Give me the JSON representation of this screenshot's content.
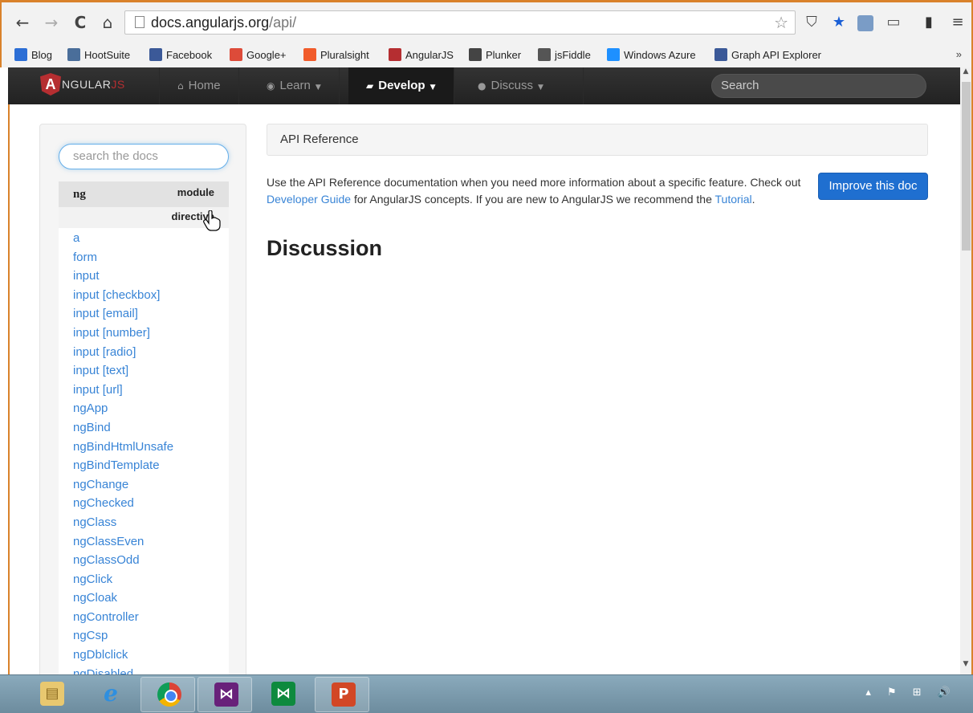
{
  "browser": {
    "url_host": "docs.angularjs.org",
    "url_path": "/api/",
    "bookmarks": [
      {
        "label": "Blog",
        "icon": "blog-icon",
        "color": "#2c6ed5"
      },
      {
        "label": "HootSuite",
        "icon": "hootsuite-icon",
        "color": "#4a6e9a"
      },
      {
        "label": "Facebook",
        "icon": "facebook-icon",
        "color": "#3b5998"
      },
      {
        "label": "Google+",
        "icon": "google-plus-icon",
        "color": "#dd4b39"
      },
      {
        "label": "Pluralsight",
        "icon": "pluralsight-icon",
        "color": "#f15b2a"
      },
      {
        "label": "AngularJS",
        "icon": "angularjs-icon",
        "color": "#b52e31"
      },
      {
        "label": "Plunker",
        "icon": "plunker-icon",
        "color": "#444444"
      },
      {
        "label": "jsFiddle",
        "icon": "jsfiddle-icon",
        "color": "#555555"
      },
      {
        "label": "Windows Azure",
        "icon": "windows-icon",
        "color": "#1e90ff"
      },
      {
        "label": "Graph API Explorer",
        "icon": "facebook-icon",
        "color": "#3b5998"
      }
    ],
    "more": "»"
  },
  "navbar": {
    "brand_prefix": "A",
    "brand_main": "NGULAR",
    "brand_suffix": "JS",
    "home": "Home",
    "learn": "Learn",
    "develop": "Develop",
    "discuss": "Discuss",
    "search_placeholder": "Search"
  },
  "sidebar": {
    "search_placeholder": "search the docs",
    "module_name": "ng",
    "module_label": "module",
    "section_label": "directive",
    "items": [
      "a",
      "form",
      "input",
      "input [checkbox]",
      "input [email]",
      "input [number]",
      "input [radio]",
      "input [text]",
      "input [url]",
      "ngApp",
      "ngBind",
      "ngBindHtmlUnsafe",
      "ngBindTemplate",
      "ngChange",
      "ngChecked",
      "ngClass",
      "ngClassEven",
      "ngClassOdd",
      "ngClick",
      "ngCloak",
      "ngController",
      "ngCsp",
      "ngDblclick",
      "ngDisabled"
    ]
  },
  "content": {
    "breadcrumb": "API Reference",
    "intro_1": "Use the API Reference documentation when you need more information about a specific feature. Check out ",
    "intro_link_1": "Developer Guide",
    "intro_2": " for AngularJS concepts. If you are new to AngularJS we recommend the ",
    "intro_link_2": "Tutorial",
    "intro_3": ".",
    "improve_button": "Improve this doc",
    "heading": "Discussion"
  },
  "taskbar": {
    "apps": [
      "file-explorer-icon",
      "internet-explorer-icon",
      "chrome-icon",
      "visual-studio-icon",
      "visual-studio-express-icon",
      "powerpoint-icon"
    ],
    "tray": "▴ ⚑ ⊞ 🔊"
  },
  "colors": {
    "accent": "#b52e31",
    "link": "#3884d6",
    "button": "#1f6fd0"
  }
}
